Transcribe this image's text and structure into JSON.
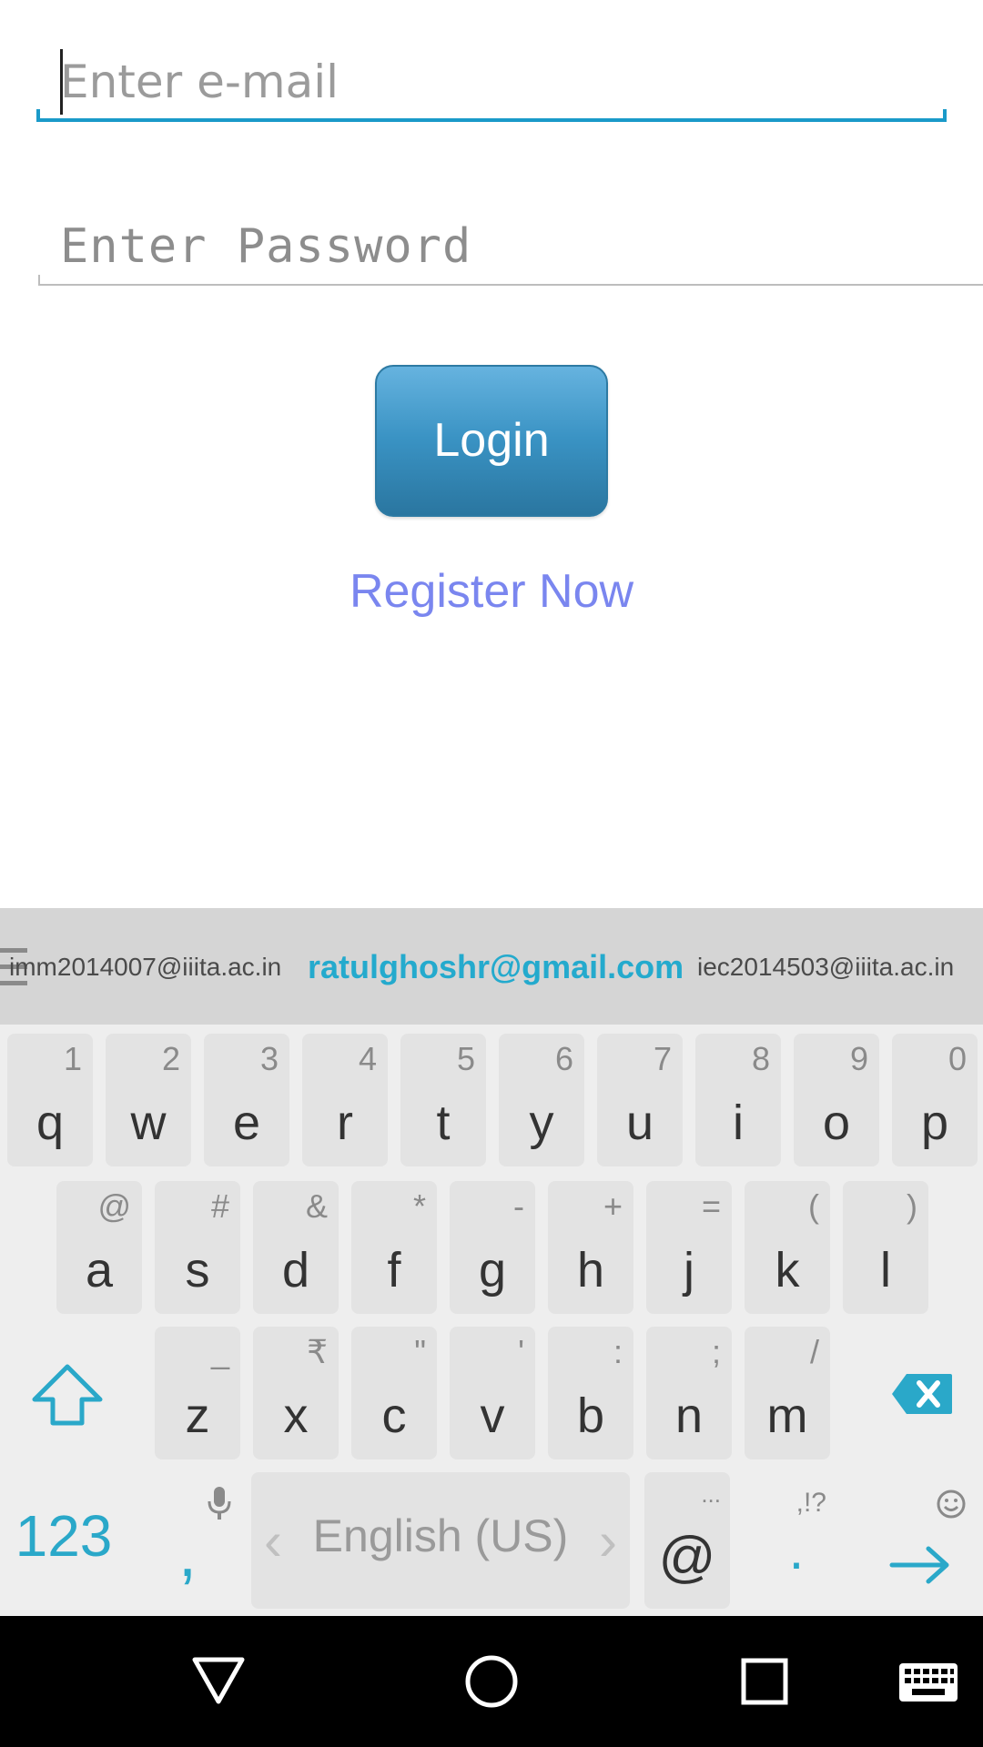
{
  "form": {
    "email_placeholder": "Enter e-mail",
    "password_placeholder": "Enter Password",
    "login_label": "Login",
    "register_label": "Register Now"
  },
  "colors": {
    "accent": "#1a9ac9",
    "button_top": "#66b3df",
    "button_bottom": "#2a76a0",
    "link": "#7a86ef",
    "keyboard_accent": "#2aa8c9"
  },
  "suggestions": {
    "left": "imm2014007@iiita.ac.in",
    "center": "ratulghoshr@gmail.com",
    "right": "iec2014503@iiita.ac.in"
  },
  "keyboard": {
    "row1": [
      {
        "key": "q",
        "hint": "1"
      },
      {
        "key": "w",
        "hint": "2"
      },
      {
        "key": "e",
        "hint": "3"
      },
      {
        "key": "r",
        "hint": "4"
      },
      {
        "key": "t",
        "hint": "5"
      },
      {
        "key": "y",
        "hint": "6"
      },
      {
        "key": "u",
        "hint": "7"
      },
      {
        "key": "i",
        "hint": "8"
      },
      {
        "key": "o",
        "hint": "9"
      },
      {
        "key": "p",
        "hint": "0"
      }
    ],
    "row2": [
      {
        "key": "a",
        "hint": "@"
      },
      {
        "key": "s",
        "hint": "#"
      },
      {
        "key": "d",
        "hint": "&"
      },
      {
        "key": "f",
        "hint": "*"
      },
      {
        "key": "g",
        "hint": "-"
      },
      {
        "key": "h",
        "hint": "+"
      },
      {
        "key": "j",
        "hint": "="
      },
      {
        "key": "k",
        "hint": "("
      },
      {
        "key": "l",
        "hint": ")"
      }
    ],
    "row3": [
      {
        "key": "z",
        "hint": "_"
      },
      {
        "key": "x",
        "hint": "₹"
      },
      {
        "key": "c",
        "hint": "\""
      },
      {
        "key": "v",
        "hint": "'"
      },
      {
        "key": "b",
        "hint": ":"
      },
      {
        "key": "n",
        "hint": ";"
      },
      {
        "key": "m",
        "hint": "/"
      }
    ],
    "numbers_label": "123",
    "comma_label": ",",
    "space_label": "English (US)",
    "at_label": "@",
    "at_hint": "...",
    "period_label": ".",
    "period_hint": ",!?"
  },
  "icons": {
    "shift": "shift-icon",
    "delete": "backspace-icon",
    "mic": "mic-icon",
    "emoji": "emoji-icon",
    "enter": "arrow-right-icon",
    "menu": "menu-icon",
    "back": "nav-back-icon",
    "home": "nav-home-icon",
    "recents": "nav-recents-icon",
    "keyboard": "keyboard-icon"
  }
}
